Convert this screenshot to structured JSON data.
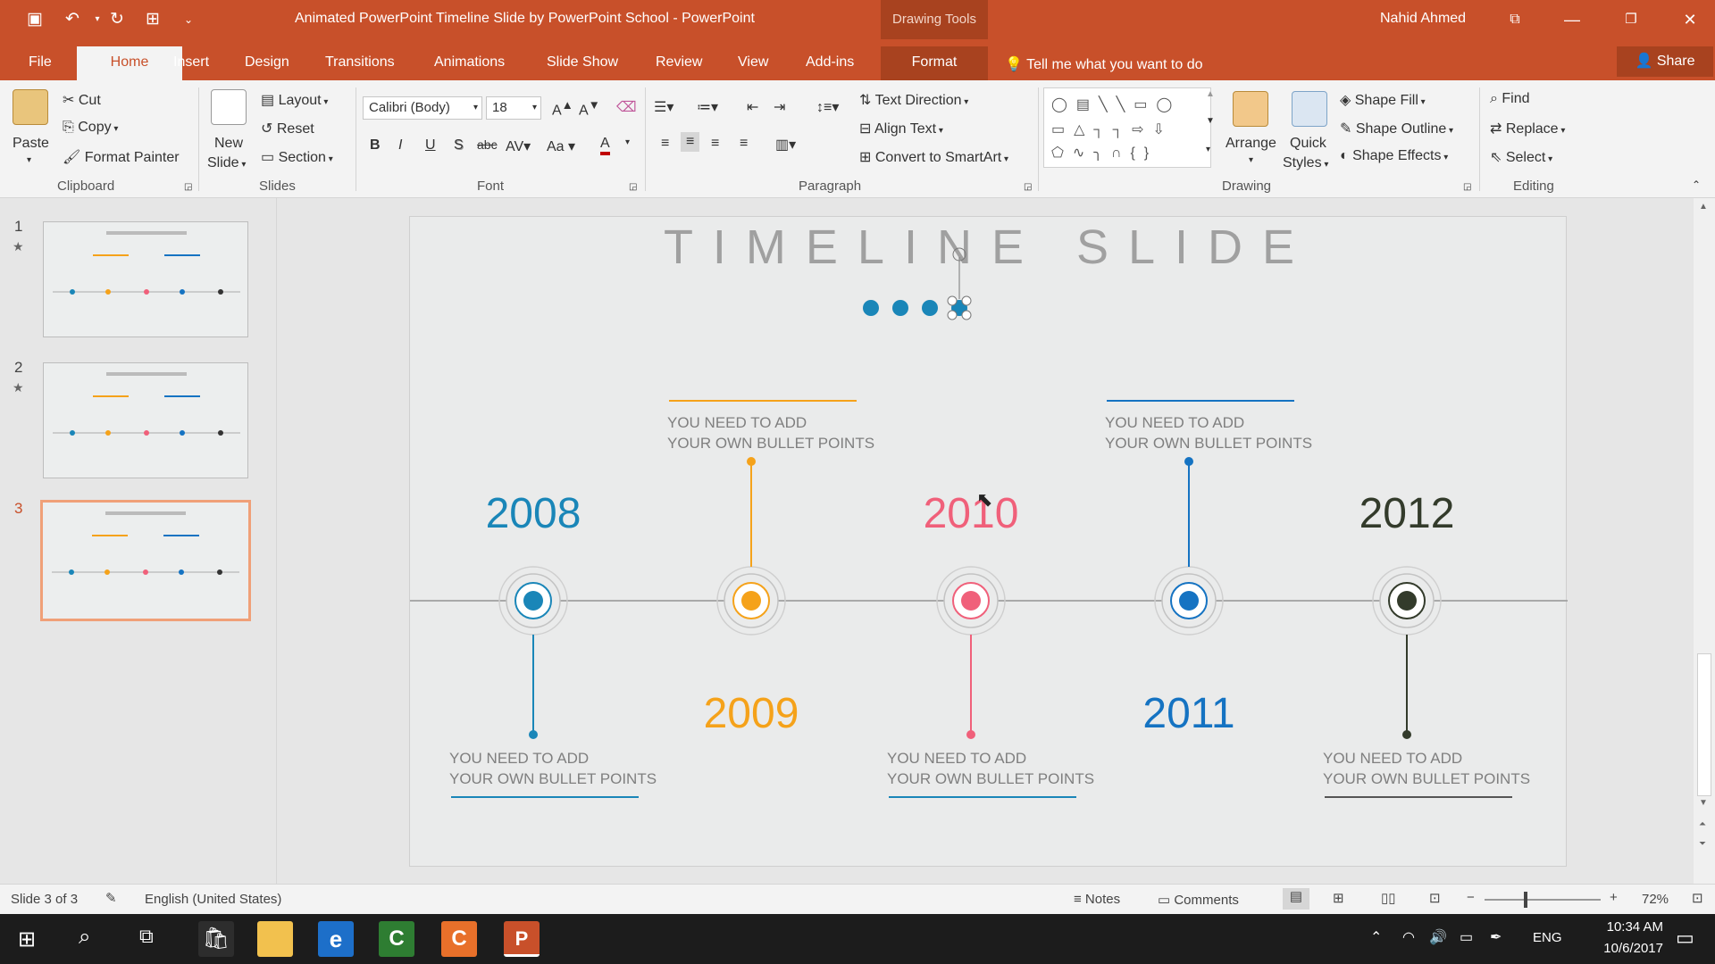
{
  "window": {
    "title": "Animated PowerPoint Timeline Slide by PowerPoint School  -  PowerPoint",
    "context_label": "Drawing Tools",
    "user": "Nahid Ahmed",
    "accent": "#c8502a"
  },
  "tabs": [
    "File",
    "Home",
    "Insert",
    "Design",
    "Transitions",
    "Animations",
    "Slide Show",
    "Review",
    "View",
    "Add-ins",
    "Format"
  ],
  "tell_me": "Tell me what you want to do",
  "share": "Share",
  "ribbon": {
    "clipboard": {
      "paste": "Paste",
      "cut": "Cut",
      "copy": "Copy",
      "format_painter": "Format Painter",
      "label": "Clipboard"
    },
    "slides": {
      "new_slide_1": "New",
      "new_slide_2": "Slide",
      "layout": "Layout",
      "reset": "Reset",
      "section": "Section",
      "label": "Slides"
    },
    "font": {
      "name": "Calibri (Body)",
      "size": "18",
      "label": "Font",
      "bold": "B",
      "italic": "I",
      "underline": "U",
      "shadow": "S",
      "strike": "abc",
      "case": "Aa"
    },
    "paragraph": {
      "text_direction": "Text Direction",
      "align_text": "Align Text",
      "convert_smartart": "Convert to SmartArt",
      "label": "Paragraph"
    },
    "drawing": {
      "arrange": "Arrange",
      "quick_1": "Quick",
      "quick_2": "Styles",
      "shape_fill": "Shape Fill",
      "shape_outline": "Shape Outline",
      "shape_effects": "Shape Effects",
      "label": "Drawing"
    },
    "editing": {
      "find": "Find",
      "replace": "Replace",
      "select": "Select",
      "label": "Editing"
    }
  },
  "thumbnails": [
    {
      "num": "1",
      "star": "★"
    },
    {
      "num": "2",
      "star": "★"
    },
    {
      "num": "3",
      "star": ""
    }
  ],
  "slide": {
    "title": "TIMELINE SLIDE",
    "bullet_line1": "YOU NEED TO ADD",
    "bullet_line2": "YOUR OWN BULLET POINTS",
    "years": [
      {
        "year": "2008",
        "color": "#1a86b8"
      },
      {
        "year": "2009",
        "color": "#f5a21a"
      },
      {
        "year": "2010",
        "color": "#f0607a"
      },
      {
        "year": "2011",
        "color": "#1573c2"
      },
      {
        "year": "2012",
        "color": "#333b2b"
      }
    ]
  },
  "status": {
    "slide": "Slide 3 of 3",
    "language": "English (United States)",
    "notes": "Notes",
    "comments": "Comments",
    "zoom": "72%"
  },
  "taskbar": {
    "lang": "ENG",
    "time": "10:34 AM",
    "date": "10/6/2017"
  }
}
